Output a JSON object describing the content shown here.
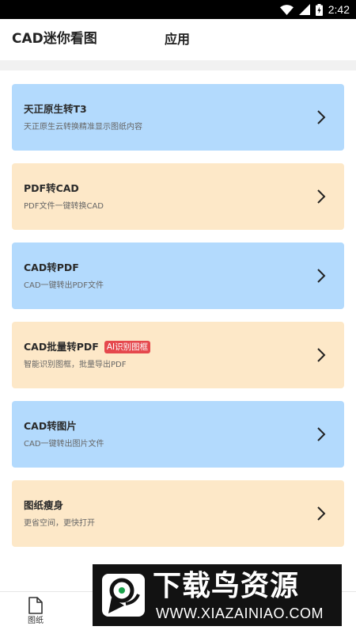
{
  "status_bar": {
    "time": "2:42"
  },
  "header": {
    "title": "CAD迷你看图",
    "tab_label": "应用"
  },
  "cards": [
    {
      "title": "天正原生转T3",
      "subtitle": "天正原生云转换精准显示图纸内容",
      "badge": "",
      "color": "#b3dafd"
    },
    {
      "title": "PDF转CAD",
      "subtitle": "PDF文件一键转换CAD",
      "badge": "",
      "color": "#fde8c8"
    },
    {
      "title": "CAD转PDF",
      "subtitle": "CAD一键转出PDF文件",
      "badge": "",
      "color": "#b3dafd"
    },
    {
      "title": "CAD批量转PDF",
      "subtitle": "智能识别图框，批量导出PDF",
      "badge": "AI识别图框",
      "color": "#fde8c8"
    },
    {
      "title": "CAD转图片",
      "subtitle": "CAD一键转出图片文件",
      "badge": "",
      "color": "#b3dafd"
    },
    {
      "title": "图纸瘦身",
      "subtitle": "更省空间，更快打开",
      "badge": "",
      "color": "#fde8c8"
    }
  ],
  "bottom_nav": {
    "drawings_label": "图纸"
  },
  "watermark": {
    "title": "下载鸟资源",
    "url": "WWW.XIAZAINIAO.COM"
  },
  "colors": {
    "card_blue": "#b3dafd",
    "card_peach": "#fde8c8",
    "badge_red": "#e5484d"
  },
  "icons": [
    "wifi-icon",
    "signal-icon",
    "battery-icon",
    "chevron-right-icon",
    "document-icon",
    "watermark-logo"
  ]
}
